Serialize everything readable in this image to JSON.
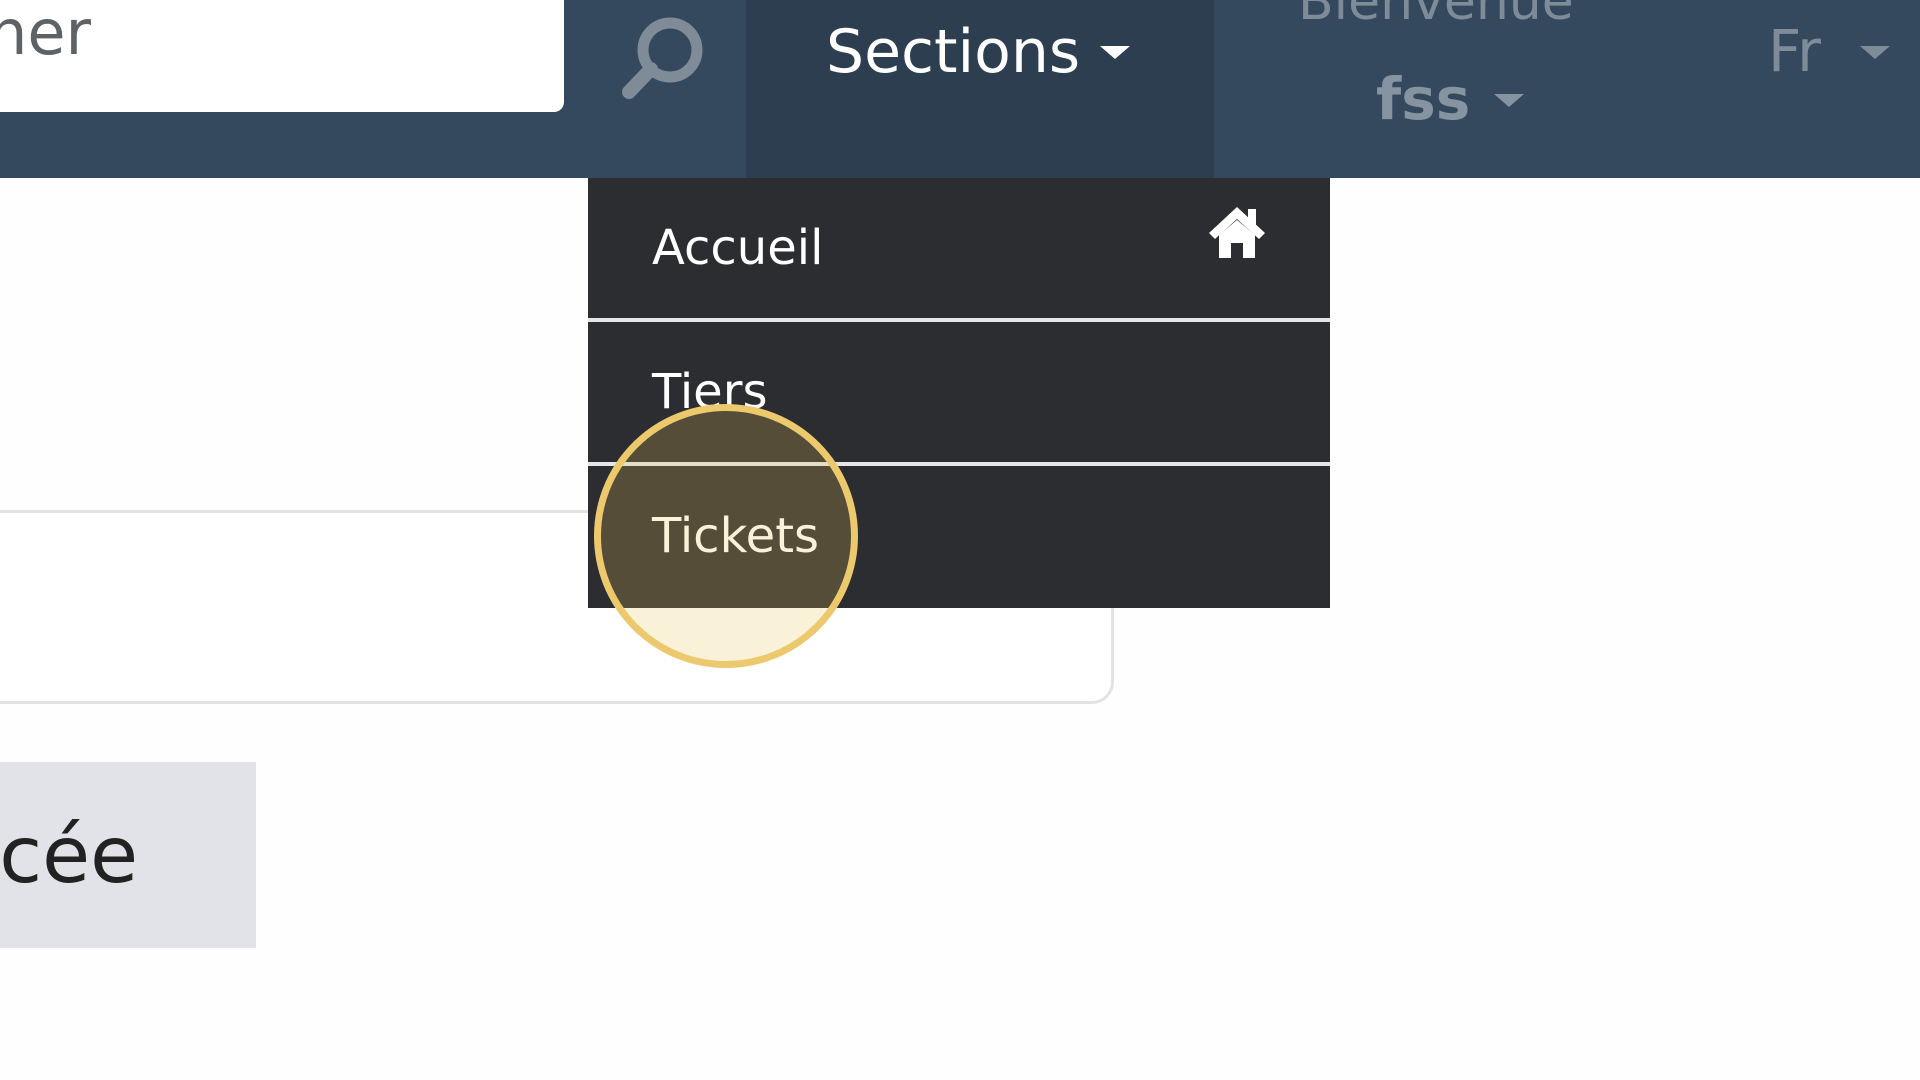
{
  "navbar": {
    "search": {
      "placeholder_partial": "cher",
      "icon": "search-icon"
    },
    "sections_label": "Sections",
    "welcome_text": "Bienvenue",
    "username": "fss",
    "language": "Fr"
  },
  "sections_menu": {
    "items": [
      {
        "label": "Accueil",
        "icon": "home-icon"
      },
      {
        "label": "Tiers"
      },
      {
        "label": "Tickets"
      }
    ]
  },
  "advanced_button_partial": "ancée",
  "colors": {
    "navbar": "#34495e",
    "navbar_active": "#2c3e50",
    "dropdown": "#2c2d30",
    "highlight": "#ecc96c",
    "button": "#e1e3e9"
  }
}
